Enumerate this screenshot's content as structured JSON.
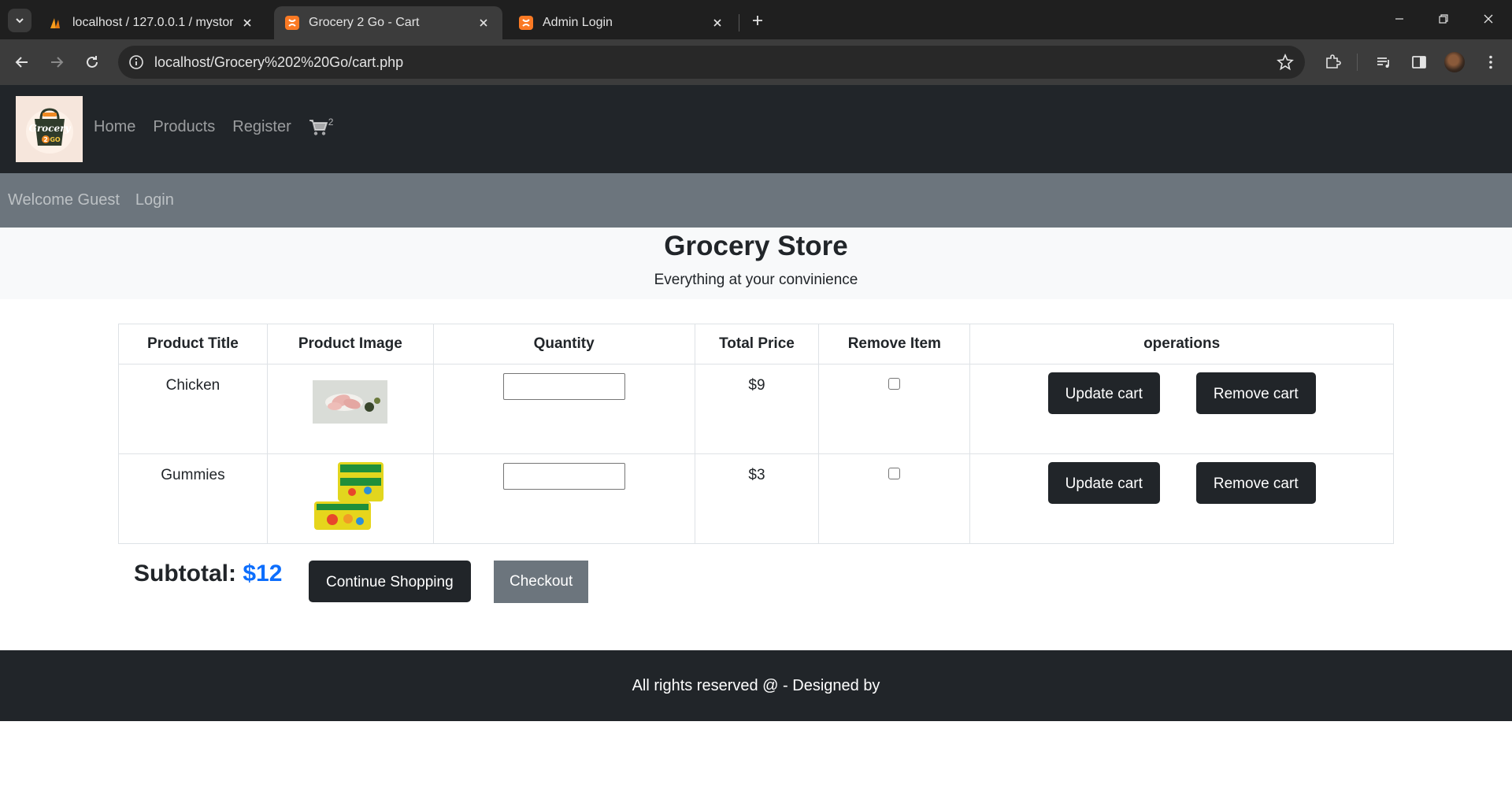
{
  "browser": {
    "tabs": [
      {
        "label": "localhost / 127.0.0.1 / mystore |",
        "active": false
      },
      {
        "label": "Grocery 2 Go - Cart",
        "active": true
      },
      {
        "label": "Admin Login",
        "active": false
      }
    ],
    "url": "localhost/Grocery%202%20Go/cart.php"
  },
  "site": {
    "logo_text": "Grocery 2 GO",
    "nav": {
      "home": "Home",
      "products": "Products",
      "register": "Register",
      "cart_count": "2"
    },
    "welcome": "Welcome Guest",
    "login": "Login",
    "hero_title": "Grocery Store",
    "hero_subtitle": "Everything at your convinience"
  },
  "cart": {
    "headers": [
      "Product Title",
      "Product Image",
      "Quantity",
      "Total Price",
      "Remove Item",
      "operations"
    ],
    "rows": [
      {
        "title": "Chicken",
        "price": "$9",
        "update_label": "Update cart",
        "remove_label": "Remove cart"
      },
      {
        "title": "Gummies",
        "price": "$3",
        "update_label": "Update cart",
        "remove_label": "Remove cart"
      }
    ],
    "subtotal_label": "Subtotal:",
    "subtotal_value": "$12",
    "continue_label": "Continue Shopping",
    "checkout_label": "Checkout"
  },
  "footer": {
    "text": "All rights reserved @ - Designed by"
  },
  "colors": {
    "nav_bg": "#212529",
    "welcome_bg": "#6c757d",
    "accent": "#0d6efd"
  }
}
